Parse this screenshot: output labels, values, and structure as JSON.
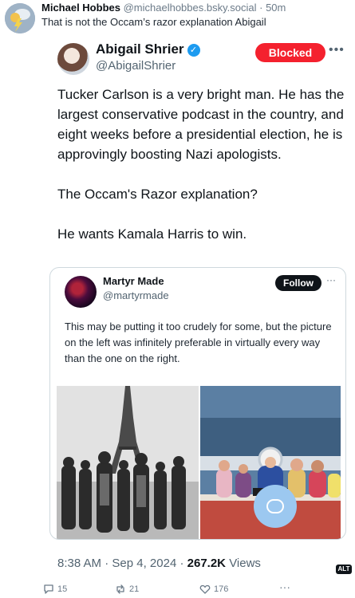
{
  "post": {
    "author_name": "Michael Hobbes",
    "author_handle": "@michaelhobbes.bsky.social",
    "separator": "·",
    "time": "50m",
    "text": "That is not the Occam’s razor explanation Abigail"
  },
  "embedded_tweet": {
    "name": "Abigail Shrier",
    "verified_glyph": "✓",
    "handle": "@AbigailShrier",
    "blocked_label": "Blocked",
    "more_glyph": "•••",
    "body": [
      "Tucker Carlson is a very bright man. He has the largest conservative podcast in the country, and eight weeks before a presidential election, he is approvingly boosting Nazi apologists.",
      "The Occam's Razor explanation?",
      "He wants Kamala Harris to win."
    ],
    "quoted": {
      "name": "Martyr Made",
      "handle": "@martyrmade",
      "follow_label": "Follow",
      "more_glyph": "···",
      "text": "This may be putting it too crudely for some, but the picture on the left was infinitely preferable in virtually every way than the one on the right."
    },
    "time": "8:38 AM",
    "separator": "·",
    "date": "Sep 4, 2024",
    "views_count": "267.2K",
    "views_label": "Views"
  },
  "alt_badge": "ALT",
  "actions": {
    "replies": "15",
    "reposts": "21",
    "likes": "176",
    "more_glyph": "···"
  },
  "icons": {
    "reply": "speech-bubble-icon",
    "repost": "repost-arrows-icon",
    "like": "heart-icon",
    "more": "ellipsis-icon",
    "fab": "compose-icon"
  },
  "colors": {
    "blocked": "#f4212e",
    "verified": "#1d9bf0",
    "fab": "#9cc8f0"
  }
}
